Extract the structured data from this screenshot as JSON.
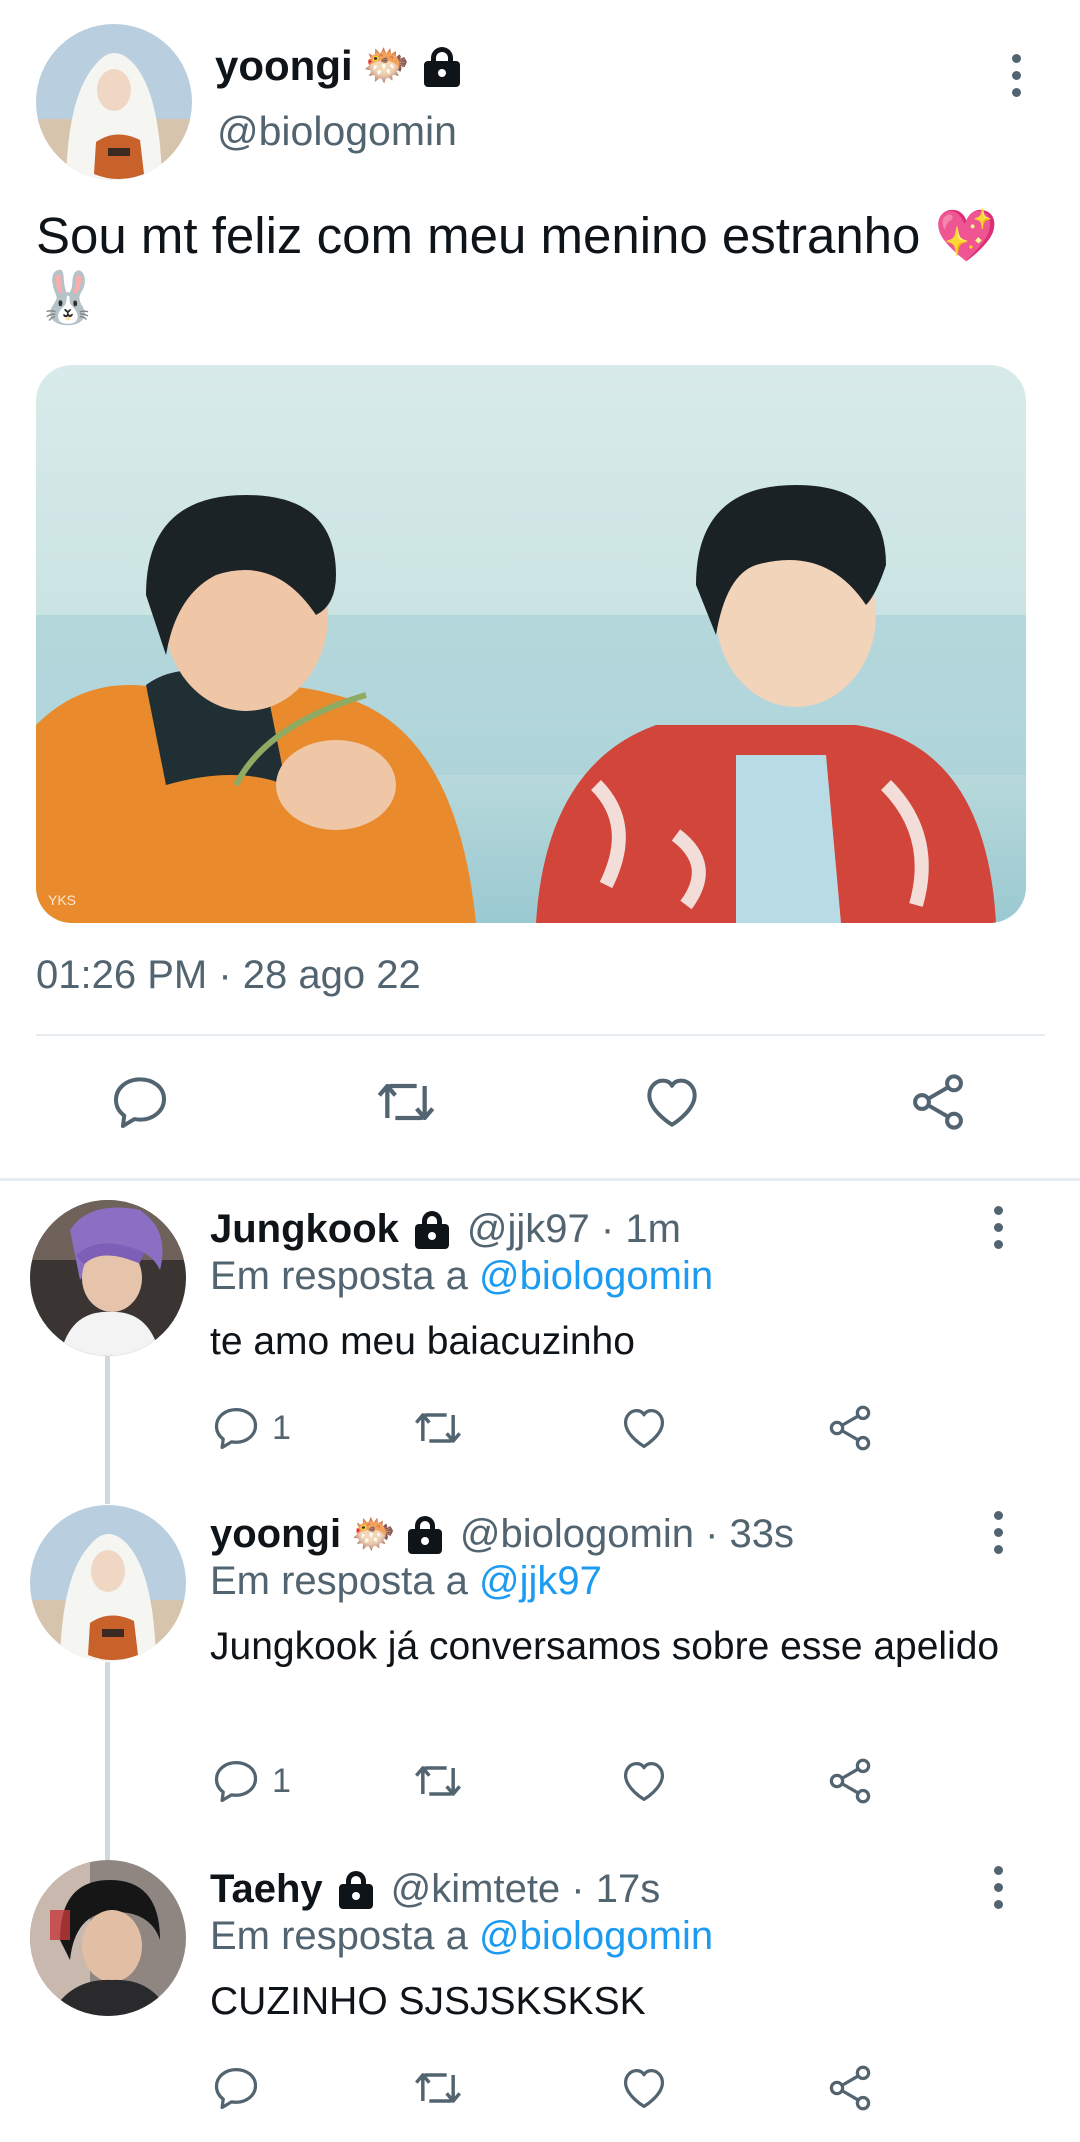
{
  "main_tweet": {
    "author": {
      "name": "yoongi",
      "emoji": "🐡",
      "handle": "@biologomin"
    },
    "text": "Sou mt feliz com meu menino estranho 💖🐰",
    "timestamp": "01:26 PM · 28 ago 22",
    "image_watermark": "YKS"
  },
  "replies": [
    {
      "name": "Jungkook",
      "emoji": "",
      "meta": "@jjk97 · 1m",
      "replying_prefix": "Em resposta a ",
      "replying_to": "@biologomin",
      "text": "te amo meu baiacuzinho",
      "reply_count": "1"
    },
    {
      "name": "yoongi",
      "emoji": "🐡",
      "meta": "@biologomin · 33s",
      "replying_prefix": "Em resposta a ",
      "replying_to": "@jjk97",
      "text": "Jungkook já conversamos sobre esse apelido",
      "reply_count": "1"
    },
    {
      "name": "Taehy",
      "emoji": "",
      "meta": "@kimtete · 17s",
      "replying_prefix": "Em resposta a ",
      "replying_to": "@biologomin",
      "text": "CUZINHO SJSJSKSKSK",
      "reply_count": ""
    }
  ],
  "icons": {
    "reply": "speech-bubble-icon",
    "retweet": "retweet-icon",
    "like": "heart-icon",
    "share": "share-icon",
    "more": "vertical-dots-icon",
    "lock": "lock-icon"
  },
  "colors": {
    "text": "#0f1419",
    "secondary": "#536471",
    "link": "#1d9bf0",
    "divider": "#e6ecf0",
    "thread_line": "#cfd9de"
  }
}
